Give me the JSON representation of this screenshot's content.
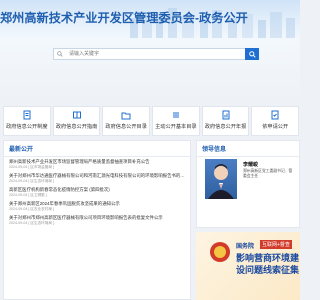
{
  "header": {
    "site_title": "郑州高新技术产业开发区管理委员会-政务公开"
  },
  "search": {
    "placeholder": "请输入关键字"
  },
  "nav": {
    "items": [
      {
        "label": "政府信息公开制度",
        "icon": "document-icon"
      },
      {
        "label": "政府信息公开指南",
        "icon": "guide-icon"
      },
      {
        "label": "政府信息公开目录",
        "icon": "folder-icon"
      },
      {
        "label": "主动公开基本目录",
        "icon": "list-icon"
      },
      {
        "label": "政府信息公开年报",
        "icon": "report-icon"
      },
      {
        "label": "依申请公开",
        "icon": "apply-icon"
      }
    ]
  },
  "news": {
    "title": "最新公开",
    "items": [
      {
        "title": "郑州高新技术产业开发区市场监督管理局严格质量监督抽查项目补充公告",
        "date": "2024-09-04 [ 区市场监管局 ]"
      },
      {
        "title": "关于对郑州市华达通医疗器械有限公司和河南汇源光电科技有限公司的环境影响报告书的批复文件公示",
        "date": "2024-09-04 [ 区生态环境局 ]"
      },
      {
        "title": "高新区医疗机构新春常态化疫情防控方案 (第四批次)",
        "date": "2024-09-04 [ 区卫健委 ]"
      },
      {
        "title": "关于郑州高新区2024年春季巩固脱贫攻坚成果的通知公示",
        "date": "2024-09-04 [ 区农业农村局 ]"
      },
      {
        "title": "关于对郑州市郑州高新区医疗器械有限公司项目环境影响报告表的批复文件公示",
        "date": "2024-09-04 [ 区生态环境局 ]"
      }
    ]
  },
  "leader": {
    "title": "领导信息",
    "name": "李耀峻",
    "duty": "郑州高新区党工委副书记、管委会主任"
  },
  "banner": {
    "brand": "国务院",
    "tag": "互联网+督查",
    "headline": "影响营商环境建设问题线索征集"
  }
}
